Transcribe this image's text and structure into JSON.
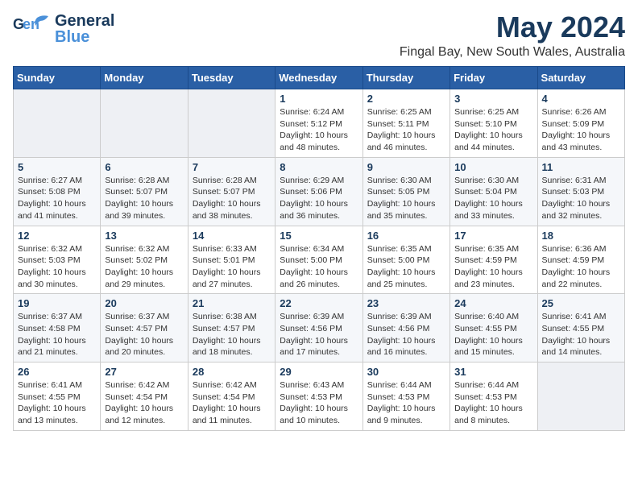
{
  "logo": {
    "line1": "General",
    "line2": "Blue"
  },
  "title": "May 2024",
  "location": "Fingal Bay, New South Wales, Australia",
  "days_header": [
    "Sunday",
    "Monday",
    "Tuesday",
    "Wednesday",
    "Thursday",
    "Friday",
    "Saturday"
  ],
  "weeks": [
    [
      {
        "day": "",
        "sunrise": "",
        "sunset": "",
        "daylight": ""
      },
      {
        "day": "",
        "sunrise": "",
        "sunset": "",
        "daylight": ""
      },
      {
        "day": "",
        "sunrise": "",
        "sunset": "",
        "daylight": ""
      },
      {
        "day": "1",
        "sunrise": "Sunrise: 6:24 AM",
        "sunset": "Sunset: 5:12 PM",
        "daylight": "Daylight: 10 hours and 48 minutes."
      },
      {
        "day": "2",
        "sunrise": "Sunrise: 6:25 AM",
        "sunset": "Sunset: 5:11 PM",
        "daylight": "Daylight: 10 hours and 46 minutes."
      },
      {
        "day": "3",
        "sunrise": "Sunrise: 6:25 AM",
        "sunset": "Sunset: 5:10 PM",
        "daylight": "Daylight: 10 hours and 44 minutes."
      },
      {
        "day": "4",
        "sunrise": "Sunrise: 6:26 AM",
        "sunset": "Sunset: 5:09 PM",
        "daylight": "Daylight: 10 hours and 43 minutes."
      }
    ],
    [
      {
        "day": "5",
        "sunrise": "Sunrise: 6:27 AM",
        "sunset": "Sunset: 5:08 PM",
        "daylight": "Daylight: 10 hours and 41 minutes."
      },
      {
        "day": "6",
        "sunrise": "Sunrise: 6:28 AM",
        "sunset": "Sunset: 5:07 PM",
        "daylight": "Daylight: 10 hours and 39 minutes."
      },
      {
        "day": "7",
        "sunrise": "Sunrise: 6:28 AM",
        "sunset": "Sunset: 5:07 PM",
        "daylight": "Daylight: 10 hours and 38 minutes."
      },
      {
        "day": "8",
        "sunrise": "Sunrise: 6:29 AM",
        "sunset": "Sunset: 5:06 PM",
        "daylight": "Daylight: 10 hours and 36 minutes."
      },
      {
        "day": "9",
        "sunrise": "Sunrise: 6:30 AM",
        "sunset": "Sunset: 5:05 PM",
        "daylight": "Daylight: 10 hours and 35 minutes."
      },
      {
        "day": "10",
        "sunrise": "Sunrise: 6:30 AM",
        "sunset": "Sunset: 5:04 PM",
        "daylight": "Daylight: 10 hours and 33 minutes."
      },
      {
        "day": "11",
        "sunrise": "Sunrise: 6:31 AM",
        "sunset": "Sunset: 5:03 PM",
        "daylight": "Daylight: 10 hours and 32 minutes."
      }
    ],
    [
      {
        "day": "12",
        "sunrise": "Sunrise: 6:32 AM",
        "sunset": "Sunset: 5:03 PM",
        "daylight": "Daylight: 10 hours and 30 minutes."
      },
      {
        "day": "13",
        "sunrise": "Sunrise: 6:32 AM",
        "sunset": "Sunset: 5:02 PM",
        "daylight": "Daylight: 10 hours and 29 minutes."
      },
      {
        "day": "14",
        "sunrise": "Sunrise: 6:33 AM",
        "sunset": "Sunset: 5:01 PM",
        "daylight": "Daylight: 10 hours and 27 minutes."
      },
      {
        "day": "15",
        "sunrise": "Sunrise: 6:34 AM",
        "sunset": "Sunset: 5:00 PM",
        "daylight": "Daylight: 10 hours and 26 minutes."
      },
      {
        "day": "16",
        "sunrise": "Sunrise: 6:35 AM",
        "sunset": "Sunset: 5:00 PM",
        "daylight": "Daylight: 10 hours and 25 minutes."
      },
      {
        "day": "17",
        "sunrise": "Sunrise: 6:35 AM",
        "sunset": "Sunset: 4:59 PM",
        "daylight": "Daylight: 10 hours and 23 minutes."
      },
      {
        "day": "18",
        "sunrise": "Sunrise: 6:36 AM",
        "sunset": "Sunset: 4:59 PM",
        "daylight": "Daylight: 10 hours and 22 minutes."
      }
    ],
    [
      {
        "day": "19",
        "sunrise": "Sunrise: 6:37 AM",
        "sunset": "Sunset: 4:58 PM",
        "daylight": "Daylight: 10 hours and 21 minutes."
      },
      {
        "day": "20",
        "sunrise": "Sunrise: 6:37 AM",
        "sunset": "Sunset: 4:57 PM",
        "daylight": "Daylight: 10 hours and 20 minutes."
      },
      {
        "day": "21",
        "sunrise": "Sunrise: 6:38 AM",
        "sunset": "Sunset: 4:57 PM",
        "daylight": "Daylight: 10 hours and 18 minutes."
      },
      {
        "day": "22",
        "sunrise": "Sunrise: 6:39 AM",
        "sunset": "Sunset: 4:56 PM",
        "daylight": "Daylight: 10 hours and 17 minutes."
      },
      {
        "day": "23",
        "sunrise": "Sunrise: 6:39 AM",
        "sunset": "Sunset: 4:56 PM",
        "daylight": "Daylight: 10 hours and 16 minutes."
      },
      {
        "day": "24",
        "sunrise": "Sunrise: 6:40 AM",
        "sunset": "Sunset: 4:55 PM",
        "daylight": "Daylight: 10 hours and 15 minutes."
      },
      {
        "day": "25",
        "sunrise": "Sunrise: 6:41 AM",
        "sunset": "Sunset: 4:55 PM",
        "daylight": "Daylight: 10 hours and 14 minutes."
      }
    ],
    [
      {
        "day": "26",
        "sunrise": "Sunrise: 6:41 AM",
        "sunset": "Sunset: 4:55 PM",
        "daylight": "Daylight: 10 hours and 13 minutes."
      },
      {
        "day": "27",
        "sunrise": "Sunrise: 6:42 AM",
        "sunset": "Sunset: 4:54 PM",
        "daylight": "Daylight: 10 hours and 12 minutes."
      },
      {
        "day": "28",
        "sunrise": "Sunrise: 6:42 AM",
        "sunset": "Sunset: 4:54 PM",
        "daylight": "Daylight: 10 hours and 11 minutes."
      },
      {
        "day": "29",
        "sunrise": "Sunrise: 6:43 AM",
        "sunset": "Sunset: 4:53 PM",
        "daylight": "Daylight: 10 hours and 10 minutes."
      },
      {
        "day": "30",
        "sunrise": "Sunrise: 6:44 AM",
        "sunset": "Sunset: 4:53 PM",
        "daylight": "Daylight: 10 hours and 9 minutes."
      },
      {
        "day": "31",
        "sunrise": "Sunrise: 6:44 AM",
        "sunset": "Sunset: 4:53 PM",
        "daylight": "Daylight: 10 hours and 8 minutes."
      },
      {
        "day": "",
        "sunrise": "",
        "sunset": "",
        "daylight": ""
      }
    ]
  ]
}
